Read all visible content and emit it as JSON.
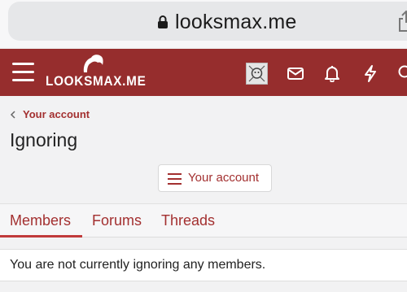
{
  "browser": {
    "url": "looksmax.me"
  },
  "header": {
    "logo_text": "LOOKSMAX.ME",
    "brand_color": "#962d2d",
    "icons": [
      "hamburger-icon",
      "avatar",
      "mail-icon",
      "bell-icon",
      "bolt-icon",
      "search-icon"
    ]
  },
  "breadcrumb": {
    "label": "Your account"
  },
  "page": {
    "title": "Ignoring",
    "account_button_label": "Your account"
  },
  "tabs": [
    {
      "label": "Members",
      "selected": true
    },
    {
      "label": "Forums",
      "selected": false
    },
    {
      "label": "Threads",
      "selected": false
    }
  ],
  "notice": {
    "text": "You are not currently ignoring any members."
  },
  "colors": {
    "accent": "#a33030",
    "background": "#f2f2f3"
  }
}
